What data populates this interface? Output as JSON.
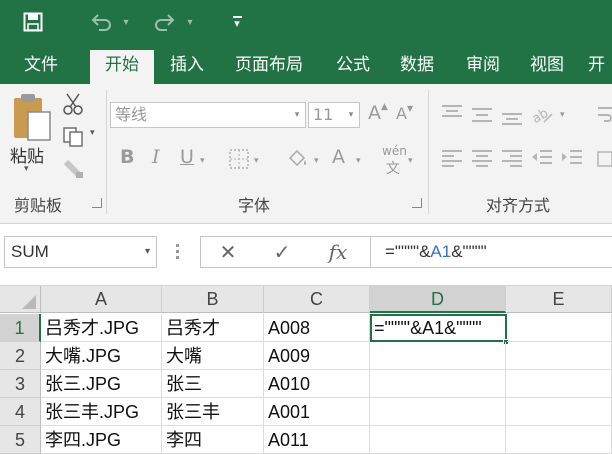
{
  "quick_access": {
    "save_icon": "save-icon",
    "undo_icon": "undo-icon",
    "redo_icon": "redo-icon",
    "customize_icon": "customize-dropdown-icon"
  },
  "tabs": [
    {
      "label": "文件",
      "active": false
    },
    {
      "label": "开始",
      "active": true
    },
    {
      "label": "插入",
      "active": false
    },
    {
      "label": "页面布局",
      "active": false
    },
    {
      "label": "公式",
      "active": false
    },
    {
      "label": "数据",
      "active": false
    },
    {
      "label": "审阅",
      "active": false
    },
    {
      "label": "视图",
      "active": false
    },
    {
      "label": "开",
      "active": false
    }
  ],
  "ribbon": {
    "clipboard": {
      "label": "剪贴板",
      "paste_label": "粘贴"
    },
    "font": {
      "label": "字体",
      "font_name": "等线",
      "font_size": "11",
      "grow_label": "A",
      "shrink_label": "A",
      "bold_label": "B",
      "italic_label": "I",
      "underline_label": "U",
      "fontcolor_label": "A",
      "phonetic_label": "wén"
    },
    "alignment": {
      "label": "对齐方式"
    }
  },
  "formula_bar": {
    "name_box": "SUM",
    "cancel_symbol": "✕",
    "enter_symbol": "✓",
    "fx_label": "fx",
    "formula_prefix": "=\"\"\"\"&",
    "formula_ref": "A1",
    "formula_suffix": "&\"\"\"\""
  },
  "sheet": {
    "columns": [
      "A",
      "B",
      "C",
      "D",
      "E"
    ],
    "selected_column": "D",
    "rows": [
      {
        "num": "1",
        "a": "吕秀才.JPG",
        "b": "吕秀才",
        "c": "A008"
      },
      {
        "num": "2",
        "a": "大嘴.JPG",
        "b": "大嘴",
        "c": "A009"
      },
      {
        "num": "3",
        "a": "张三.JPG",
        "b": "张三",
        "c": "A010"
      },
      {
        "num": "4",
        "a": "张三丰.JPG",
        "b": "张三丰",
        "c": "A001"
      },
      {
        "num": "5",
        "a": "李四.JPG",
        "b": "李四",
        "c": "A011"
      }
    ],
    "active_cell": {
      "ref": "D1",
      "prefix": "=\"\"\"\"&",
      "ref_text": "A1",
      "suffix": "&\"\"\"\""
    }
  },
  "colors": {
    "brand": "#217346",
    "formula_ref": "#2f6fd6"
  }
}
